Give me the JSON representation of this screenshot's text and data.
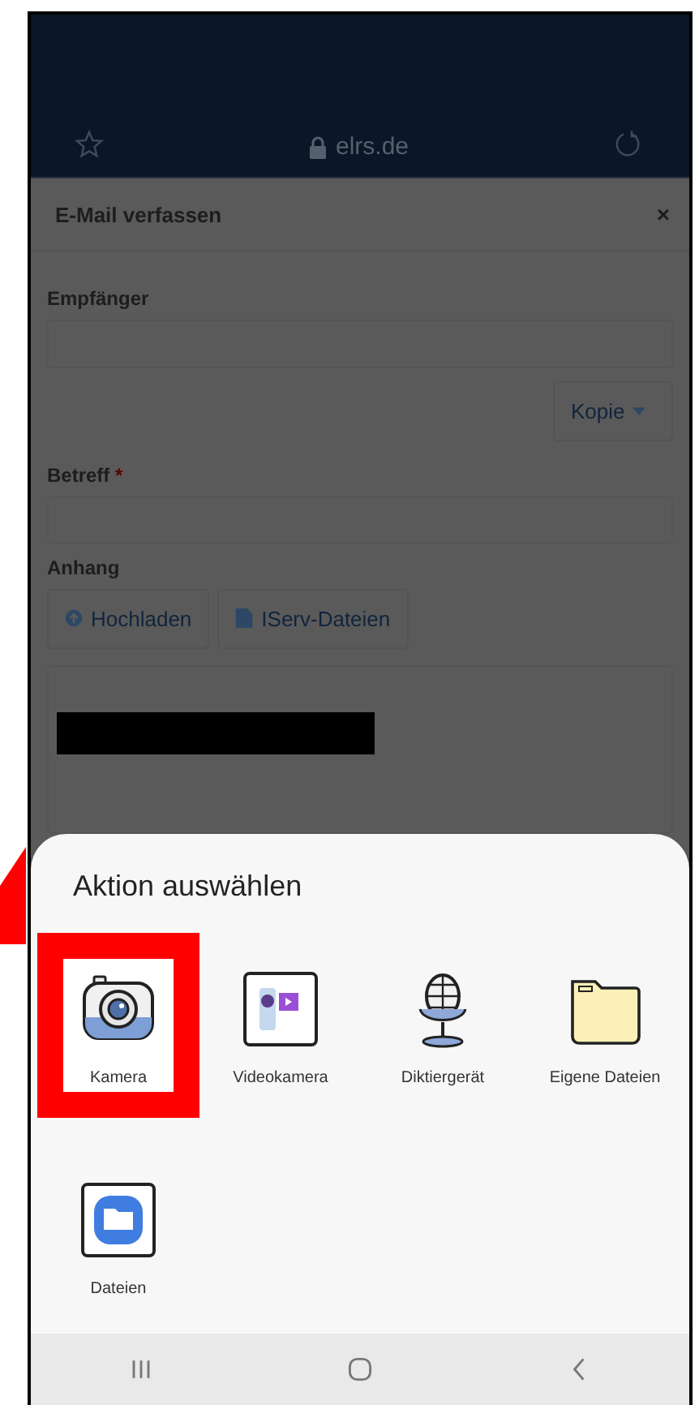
{
  "browser": {
    "url": "elrs.de"
  },
  "dialog": {
    "title": "E-Mail verfassen",
    "close": "×",
    "recipient": {
      "label": "Empfänger"
    },
    "copy_button": {
      "label": "Kopie"
    },
    "subject": {
      "label": "Betreff",
      "required_mark": "*"
    },
    "attachment": {
      "label": "Anhang",
      "buttons": [
        {
          "label": "Hochladen",
          "kind": "upload"
        },
        {
          "label": "IServ-Dateien",
          "kind": "file"
        }
      ]
    },
    "message": {
      "redacted": true
    }
  },
  "sheet": {
    "title": "Aktion auswählen",
    "apps": [
      {
        "label": "Kamera",
        "kind": "camera",
        "highlighted": true
      },
      {
        "label": "Videokamera",
        "kind": "video",
        "highlighted": false
      },
      {
        "label": "Diktiergerät",
        "kind": "mic",
        "highlighted": false
      },
      {
        "label": "Eigene Dateien",
        "kind": "folder",
        "highlighted": false
      },
      {
        "label": "Dateien",
        "kind": "files",
        "highlighted": false
      }
    ]
  }
}
